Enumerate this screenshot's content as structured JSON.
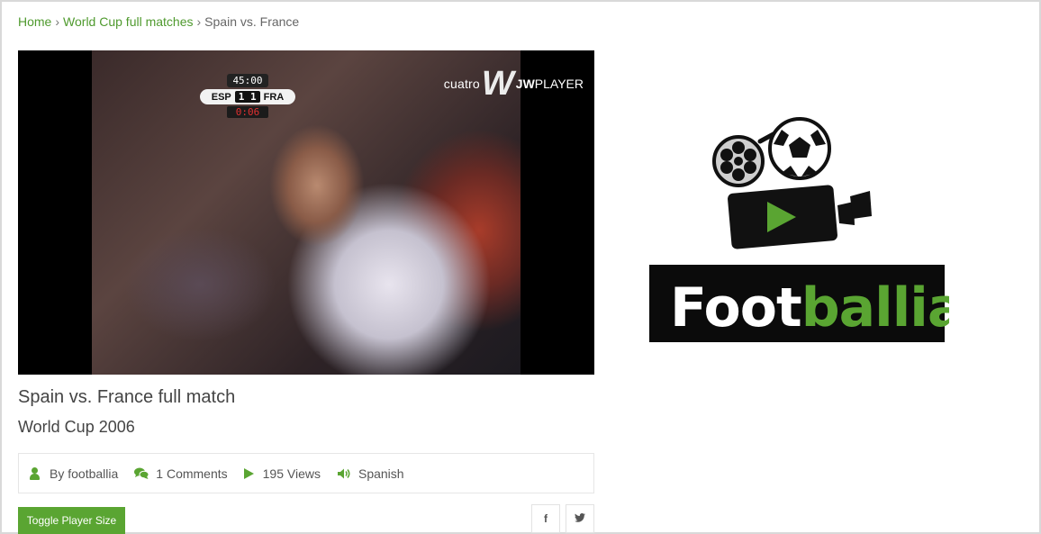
{
  "breadcrumb": {
    "home": "Home",
    "category": "World Cup full matches",
    "current": "Spain vs. France",
    "separator": "›"
  },
  "player": {
    "scoreboard": {
      "clock": "45:00",
      "home_team": "ESP",
      "score": "1 1",
      "away_team": "FRA",
      "added_time": "0:06"
    },
    "watermark_channel": "cuatro",
    "watermark_brand_bold": "JW",
    "watermark_brand_rest": "PLAYER"
  },
  "video": {
    "title": "Spain vs. France full match",
    "subtitle": "World Cup 2006"
  },
  "meta": {
    "author": "By footballia",
    "comments": "1 Comments",
    "views": "195 Views",
    "language": "Spanish"
  },
  "actions": {
    "toggle_player_size": "Toggle Player Size",
    "facebook_glyph": "f",
    "twitter_glyph": "🐦"
  },
  "logo": {
    "text_white": "Foot",
    "text_green": "ballia"
  },
  "colors": {
    "accent": "#5aa532",
    "link": "#4f9a2e",
    "logo_green": "#5aa532"
  },
  "icons": {
    "author": "user-icon",
    "comments": "comments-icon",
    "views": "play-icon",
    "language": "volume-icon",
    "facebook": "facebook-icon",
    "twitter": "twitter-icon"
  }
}
